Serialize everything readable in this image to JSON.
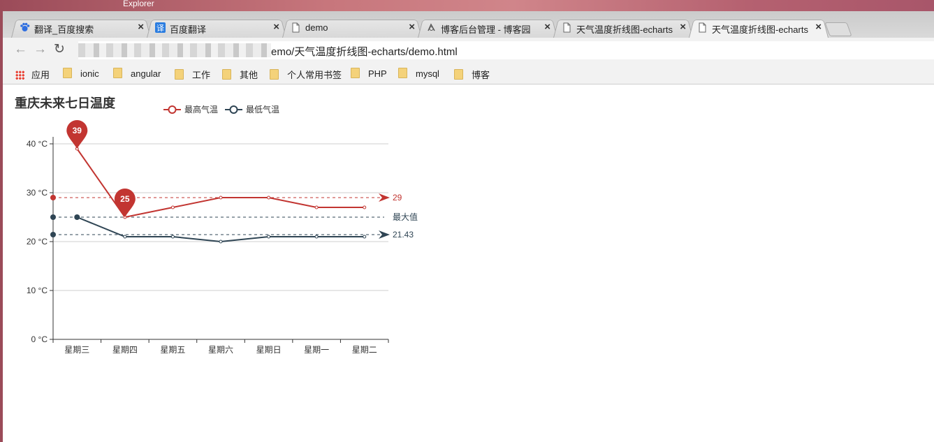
{
  "desktop": {
    "title": "Explorer"
  },
  "tabs": [
    {
      "title": "翻译_百度搜索",
      "icon": "baidu-paw-icon",
      "close": "×"
    },
    {
      "title": "百度翻译",
      "icon": "translate-icon",
      "close": "×"
    },
    {
      "title": "demo",
      "icon": "page-icon",
      "close": "×"
    },
    {
      "title": "博客后台管理 - 博客园",
      "icon": "cnblogs-icon",
      "close": "×"
    },
    {
      "title": "天气温度折线图-echarts",
      "icon": "page-icon",
      "close": "×"
    },
    {
      "title": "天气温度折线图-echarts",
      "icon": "page-icon",
      "close": "×",
      "active": true
    }
  ],
  "toolbar": {
    "back": "←",
    "forward": "→",
    "reload": "↻",
    "address_visible": "emo/天气温度折线图-echarts/demo.html"
  },
  "bookmarks": [
    {
      "label": "应用",
      "icon": "apps-grid-icon"
    },
    {
      "label": "ionic",
      "icon": "folder-icon"
    },
    {
      "label": "angular",
      "icon": "folder-icon"
    },
    {
      "label": "工作",
      "icon": "folder-icon"
    },
    {
      "label": "其他",
      "icon": "folder-icon"
    },
    {
      "label": "个人常用书签",
      "icon": "folder-icon"
    },
    {
      "label": "PHP",
      "icon": "folder-icon"
    },
    {
      "label": "mysql",
      "icon": "folder-icon"
    },
    {
      "label": "博客",
      "icon": "folder-icon"
    }
  ],
  "chart_data": {
    "type": "line",
    "title": "重庆未来七日温度",
    "categories": [
      "星期三",
      "星期四",
      "星期五",
      "星期六",
      "星期日",
      "星期一",
      "星期二"
    ],
    "y_ticks": [
      "40 °C",
      "30 °C",
      "20 °C",
      "10 °C",
      "0 °C"
    ],
    "ylim": [
      0,
      40
    ],
    "grid": true,
    "legend_position": "top-center",
    "series": [
      {
        "name": "最高气温",
        "color": "#c23531",
        "values": [
          39,
          25,
          27,
          29,
          29,
          27,
          27
        ],
        "mark_points": [
          {
            "value": "39",
            "index": 0
          },
          {
            "value": "25",
            "index": 1
          }
        ],
        "mark_line": {
          "value": 29,
          "label": "29"
        }
      },
      {
        "name": "最低气温",
        "color": "#2f4554",
        "values": [
          25,
          21,
          21,
          20,
          21,
          21,
          21
        ],
        "mark_lines": [
          {
            "value": 25,
            "label": "最大值"
          },
          {
            "value": 21.43,
            "label": "21.43"
          }
        ]
      }
    ]
  }
}
